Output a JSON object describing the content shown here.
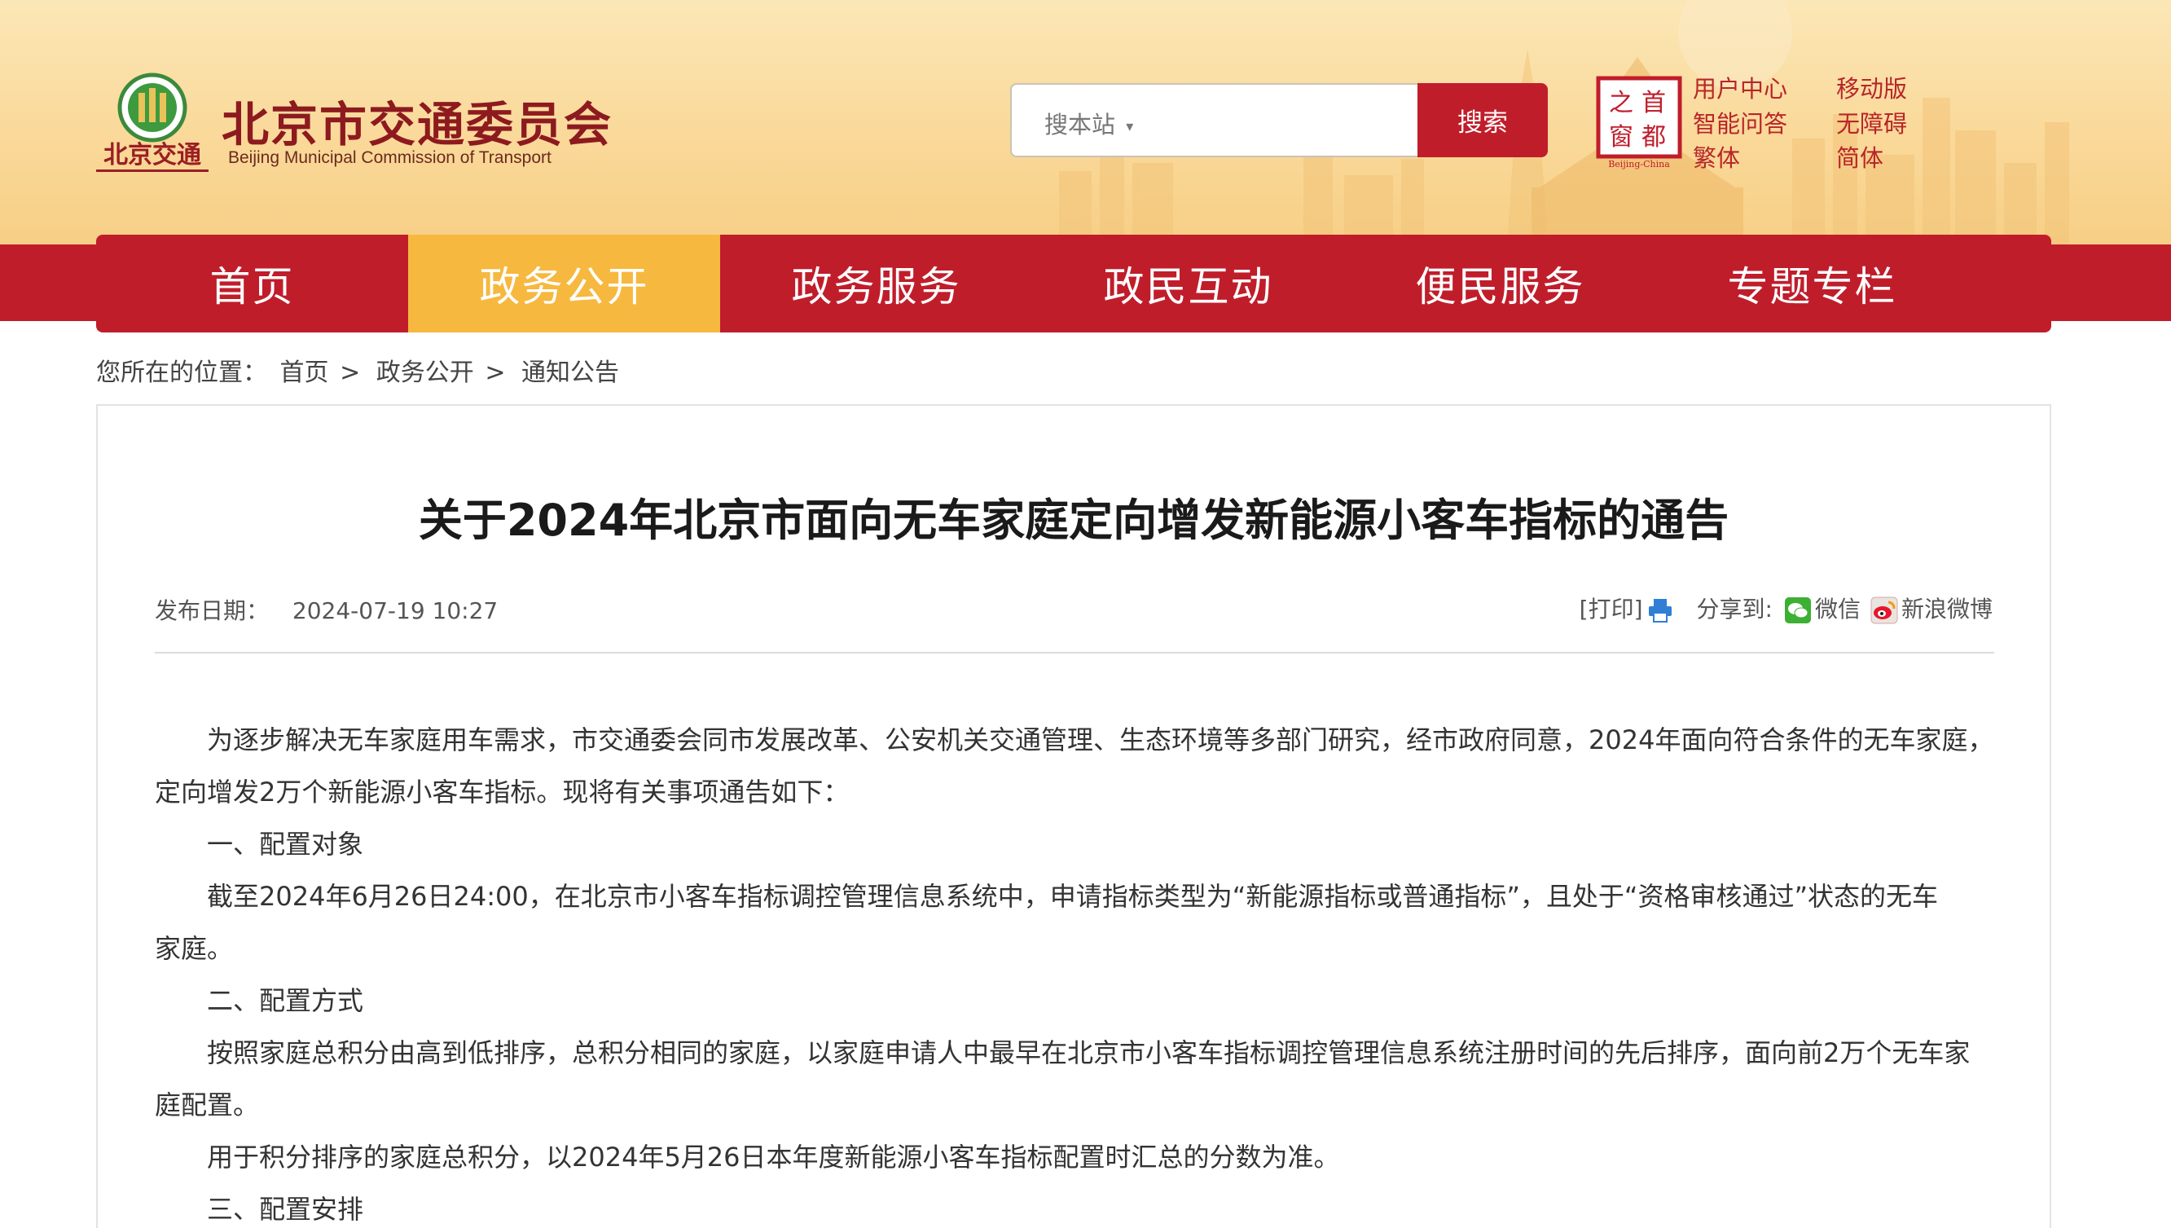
{
  "header": {
    "logo_text": "北京交通",
    "site_name": "北京市交通委员会",
    "site_sub": "Beijing Municipal Commission of Transport",
    "search": {
      "scope": "搜本站",
      "button": "搜索",
      "placeholder": ""
    },
    "seal_chars": [
      "首",
      "都",
      "之",
      "窗"
    ],
    "seal_sub": "Beijing-China",
    "quick_links": [
      "用户中心",
      "移动版",
      "智能问答",
      "无障碍",
      "繁体",
      "简体"
    ]
  },
  "nav": {
    "items": [
      "首页",
      "政务公开",
      "政务服务",
      "政民互动",
      "便民服务",
      "专题专栏"
    ],
    "active": "政务公开"
  },
  "breadcrumb": {
    "label": "您所在的位置：",
    "items": [
      "首页",
      "政务公开",
      "通知公告"
    ],
    "separator": ">"
  },
  "article": {
    "title": "关于2024年北京市面向无车家庭定向增发新能源小客车指标的通告",
    "date_label": "发布日期：",
    "date": "2024-07-19 10:27",
    "print": "[打印]",
    "share_label": "分享到:",
    "wechat": "微信",
    "weibo": "新浪微博",
    "paragraphs": [
      "为逐步解决无车家庭用车需求，市交通委会同市发展改革、公安机关交通管理、生态环境等多部门研究，经市政府同意，2024年面向符合条件的无车家庭，",
      "定向增发2万个新能源小客车指标。现将有关事项通告如下：",
      "一、配置对象",
      "截至2024年6月26日24:00，在北京市小客车指标调控管理信息系统中，申请指标类型为“新能源指标或普通指标”，且处于“资格审核通过”状态的无车",
      "家庭。",
      "二、配置方式",
      "按照家庭总积分由高到低排序，总积分相同的家庭，以家庭申请人中最早在北京市小客车指标调控管理信息系统注册时间的先后排序，面向前2万个无车家",
      "庭配置。",
      "用于积分排序的家庭总积分，以2024年5月26日本年度新能源小客车指标配置时汇总的分数为准。",
      "三、配置安排"
    ]
  },
  "colors": {
    "brand_red": "#c01d2b",
    "active_tab": "#f6b83f",
    "header_bg": "#fad99a",
    "title_text": "#8d1a1f"
  }
}
